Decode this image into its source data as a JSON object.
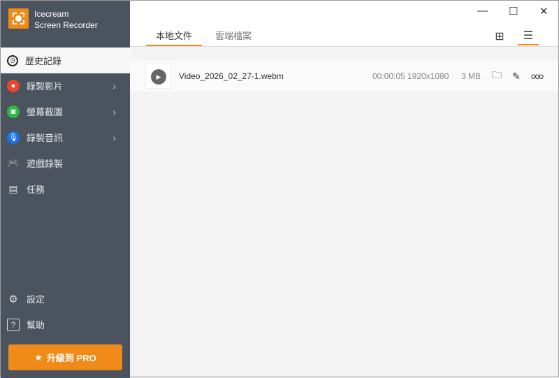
{
  "app": {
    "name_line1": "Icecream",
    "name_line2": "Screen Recorder"
  },
  "sidebar": {
    "items": [
      {
        "label": "歷史記錄",
        "icon": "clock-icon"
      },
      {
        "label": "錄製影片",
        "icon": "record-icon",
        "color": "#e8452c"
      },
      {
        "label": "螢幕截圖",
        "icon": "camera-icon",
        "color": "#2fb84a"
      },
      {
        "label": "錄製音訊",
        "icon": "microphone-icon",
        "color": "#1a73e8"
      },
      {
        "label": "遊戲錄製",
        "icon": "gamepad-icon"
      },
      {
        "label": "任務",
        "icon": "task-icon"
      }
    ],
    "settings": "設定",
    "help": "幫助",
    "upgrade": "升級到 PRO"
  },
  "tabs": [
    "本地文件",
    "雲端檔案"
  ],
  "files": [
    {
      "name": "Video_2026_02_27-1.webm",
      "duration": "00:00:05",
      "resolution": "1920x1080",
      "size": "3 MB"
    }
  ],
  "colors": {
    "accent": "#f08a18",
    "sidebar": "#4b535e"
  }
}
